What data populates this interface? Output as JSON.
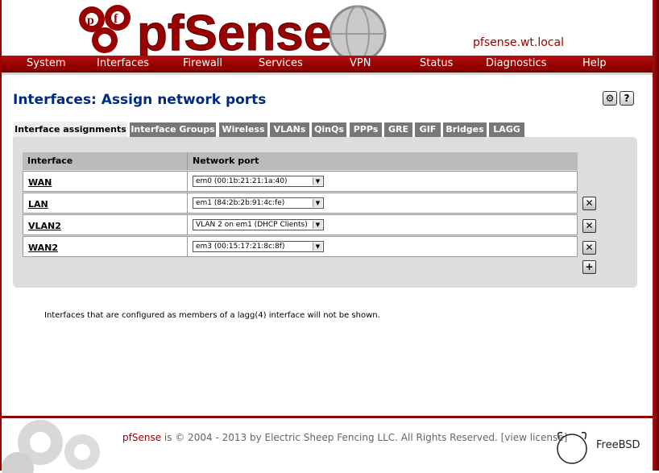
{
  "header": {
    "logo_text": "pfSense",
    "hostname": "pfsense.wt.local"
  },
  "nav": [
    "System",
    "Interfaces",
    "Firewall",
    "Services",
    "VPN",
    "Status",
    "Diagnostics",
    "Help"
  ],
  "page": {
    "title": "Interfaces: Assign network ports",
    "tool_icons": [
      "gear-icon",
      "help-icon"
    ]
  },
  "tabs": [
    "Interface assignments",
    "Interface Groups",
    "Wireless",
    "VLANs",
    "QinQs",
    "PPPs",
    "GRE",
    "GIF",
    "Bridges",
    "LAGG"
  ],
  "active_tab": "Interface assignments",
  "table": {
    "headers": [
      "Interface",
      "Network port"
    ],
    "rows": [
      {
        "interface": "WAN",
        "port": "em0 (00:1b:21:21:1a:40)",
        "deletable": false
      },
      {
        "interface": "LAN",
        "port": "em1 (84:2b:2b:91:4c:fe)",
        "deletable": true
      },
      {
        "interface": "VLAN2",
        "port": "VLAN 2 on em1 (DHCP Clients)",
        "deletable": true
      },
      {
        "interface": "WAN2",
        "port": "em3 (00:15:17:21:8c:8f)",
        "deletable": true
      }
    ]
  },
  "note": "Interfaces that are configured as members of a lagg(4) interface will not be shown.",
  "footer": {
    "brand": "pfSense",
    "text": " is © 2004 - 2013 by Electric Sheep Fencing LLC. All Rights Reserved. [view license]",
    "freebsd": "FreeBSD"
  },
  "colors": {
    "brand_red": "#990000",
    "title_blue": "#002a80",
    "tab_gray": "#777777"
  }
}
